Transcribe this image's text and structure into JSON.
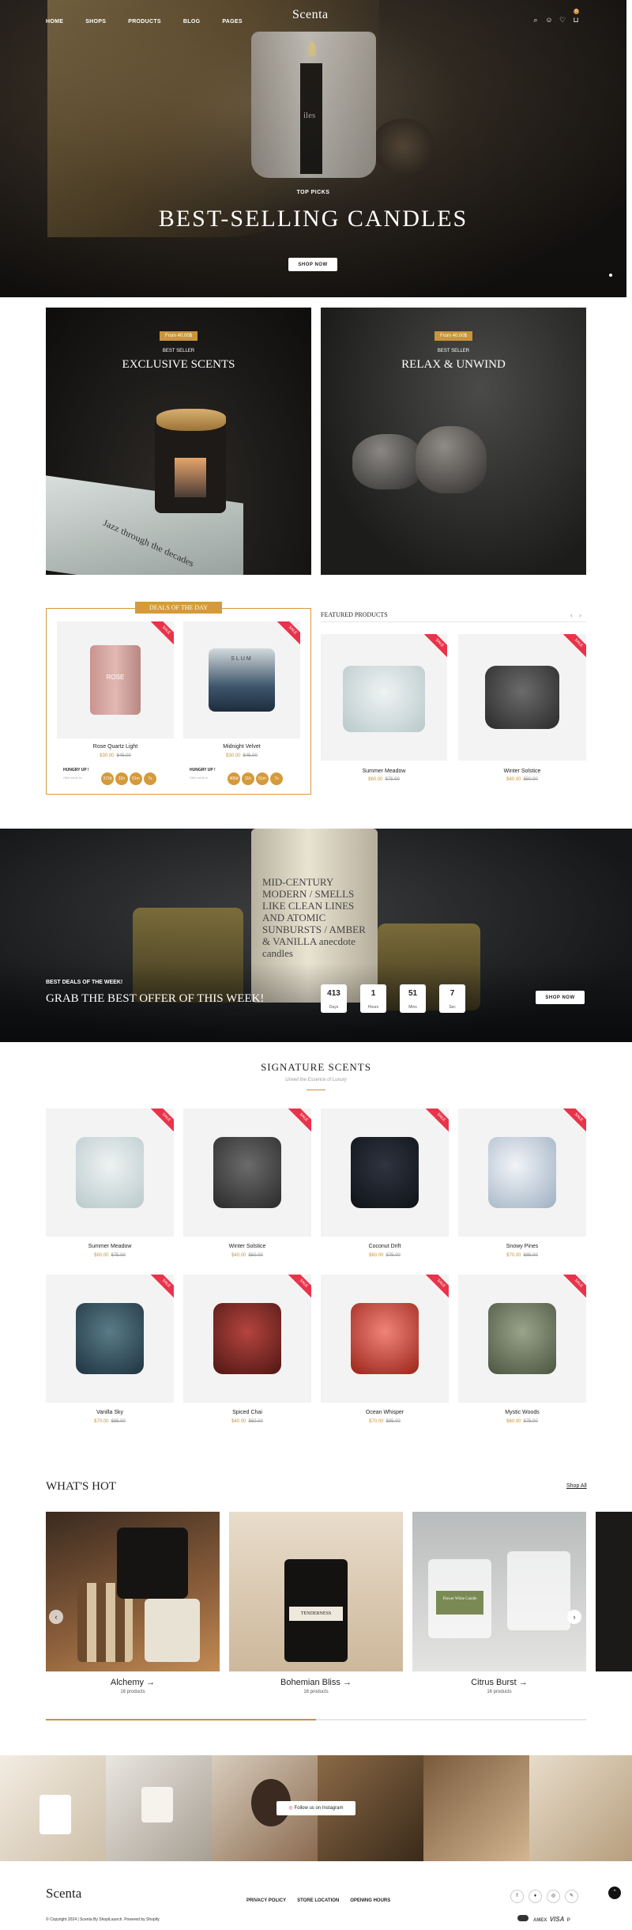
{
  "header": {
    "logo": "Scenta",
    "nav": [
      "HOME",
      "SHOPS",
      "PRODUCTS",
      "BLOG",
      "PAGES"
    ],
    "cart_count": "0"
  },
  "hero": {
    "kicker": "TOP PICKS",
    "title": "BEST-SELLING CANDLES",
    "button": "SHOP NOW",
    "jar_text": "iles"
  },
  "banners": [
    {
      "pill": "From 40.00$",
      "kicker": "BEST SELLER",
      "title": "EXCLUSIVE SCENTS",
      "book_text": "Jazz through the decades"
    },
    {
      "pill": "From 40.00$",
      "kicker": "BEST SELLER",
      "title": "RELAX & UNWIND"
    }
  ],
  "deals": {
    "badge": "DEALS OF THE DAY",
    "hurry": "HUNGRY UP !",
    "offer": "Offer ends in:",
    "products": [
      {
        "name": "Rose Quartz Light",
        "now": "$30.00",
        "was": "$45.00",
        "sale": "SALE",
        "img_text": "ROSE",
        "timer": [
          "372d",
          "11h",
          "51m",
          "7s"
        ]
      },
      {
        "name": "Midnight Velvet",
        "now": "$30.00",
        "was": "$45.00",
        "sale": "SALE",
        "img_text": "SLUM",
        "timer": [
          "406d",
          "11h",
          "51m",
          "7s"
        ]
      }
    ]
  },
  "featured": {
    "title": "FEATURED PRODUCTS",
    "prev": "‹",
    "next": "›",
    "products": [
      {
        "name": "Summer Meadow",
        "now": "$60.00",
        "was": "$75.00",
        "sale": "SALE"
      },
      {
        "name": "Winter Solstice",
        "now": "$40.00",
        "was": "$50.00",
        "sale": "SALE"
      }
    ]
  },
  "offer": {
    "kicker": "BEST DEALS OF THE WEEK!",
    "title": "GRAB THE BEST OFFER OF THIS WEEK!",
    "button": "SHOP NOW",
    "jar_text": "MID-CENTURY MODERN / SMELLS LIKE CLEAN LINES AND ATOMIC SUNBURSTS / AMBER & VANILLA anecdote candles",
    "countdown": [
      {
        "v": "413",
        "l": "Days"
      },
      {
        "v": "1",
        "l": "Hours"
      },
      {
        "v": "51",
        "l": "Mins"
      },
      {
        "v": "7",
        "l": "Sec"
      }
    ]
  },
  "signature": {
    "title": "SIGNATURE SCENTS",
    "subtitle": "Unveil the Essence of Luxury",
    "products": [
      {
        "name": "Summer Meadow",
        "now": "$60.00",
        "was": "$75.00",
        "sale": "SALE"
      },
      {
        "name": "Winter Solstice",
        "now": "$40.00",
        "was": "$50.00",
        "sale": "SALE"
      },
      {
        "name": "Coconut Drift",
        "now": "$60.00",
        "was": "$75.00",
        "sale": "SALE"
      },
      {
        "name": "Snowy Pines",
        "now": "$70.00",
        "was": "$85.00",
        "sale": "SALE"
      },
      {
        "name": "Vanilla Sky",
        "now": "$70.00",
        "was": "$85.00",
        "sale": "SALE"
      },
      {
        "name": "Spiced Chai",
        "now": "$40.00",
        "was": "$50.00",
        "sale": "SALE"
      },
      {
        "name": "Ocean Whisper",
        "now": "$70.00",
        "was": "$85.00",
        "sale": "SALE"
      },
      {
        "name": "Mystic Woods",
        "now": "$60.00",
        "was": "$75.00",
        "sale": "SALE"
      }
    ]
  },
  "hot": {
    "title": "WHAT'S HOT",
    "shop_all": "Shop All",
    "prev": "‹",
    "next": "›",
    "items": [
      {
        "name": "Alchemy",
        "count": "16 products"
      },
      {
        "name": "Bohemian Bliss",
        "count": "16 products",
        "jar_text": "TENDERNESS"
      },
      {
        "name": "Citrus Burst",
        "count": "16 products",
        "jar_text": "Flower White Candle"
      }
    ],
    "progress": 0.5
  },
  "instagram": {
    "button": "Follow us on Instagram"
  },
  "footer": {
    "logo": "Scenta",
    "links": [
      "PRIVACY POLICY",
      "STORE LOCATION",
      "OPENING HOURS"
    ],
    "copyright": "© Copyright 2024 | Scenta By ShopiLaunch. Powered by Shopify.",
    "payments": [
      "AMEX",
      "VISA",
      "P"
    ],
    "social": [
      "f",
      "♦",
      "◎",
      "✎"
    ],
    "top": "⌃"
  },
  "colors": {
    "accent": "#c9943a",
    "sale": "#e8334a"
  }
}
